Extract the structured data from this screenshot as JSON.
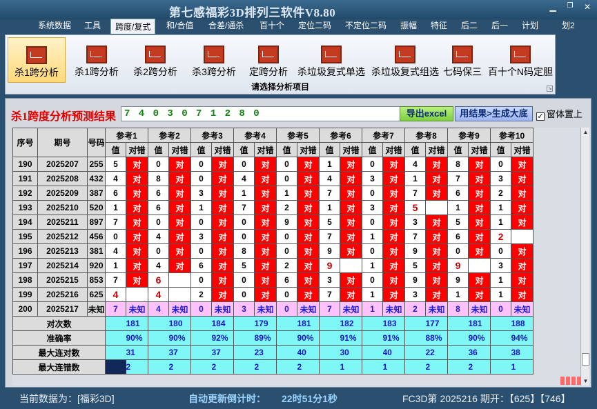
{
  "window": {
    "title": "第七感福彩3D排列三软件V8.80",
    "restore_icon": "restore-icon",
    "close_icon": "close-icon"
  },
  "menu": {
    "items": [
      "系统数据",
      "工具",
      "跨度/复式",
      "和/合值",
      "合差/通杀",
      "百十个",
      "定位二码",
      "不定位二码",
      "振幅",
      "特征",
      "后二",
      "后一",
      "计划",
      "划2"
    ],
    "active": "跨度/复式"
  },
  "ribbon": {
    "buttons": [
      "杀1跨分析",
      "杀1跨分析",
      "杀2跨分析",
      "杀3跨分析",
      "定跨分析",
      "杀垃圾复式单选",
      "杀垃圾复式组选",
      "七码保三",
      "百十个N码定胆"
    ],
    "selected_index": 0,
    "icon_name": "chart-icon",
    "caption": "请选择分析项目"
  },
  "result": {
    "label": "杀1跨度分析预测结果",
    "value": "7 4 0 3 0 7 1 2 8 0",
    "export_label": "导出excel",
    "generate_label": "用结果>生成大底",
    "topmost_label": "窗体置上",
    "topmost_checked": true
  },
  "table": {
    "headers": {
      "seq": "序号",
      "period": "期号",
      "number": "号码"
    },
    "ref_groups": [
      "参考1",
      "参考2",
      "参考3",
      "参考4",
      "参考5",
      "参考6",
      "参考7",
      "参考8",
      "参考9",
      "参考10"
    ],
    "sub_headers": {
      "value": "值",
      "result": "对错"
    },
    "result_labels": {
      "correct": "对",
      "wrong": "错",
      "unknown": "未知"
    },
    "rows": [
      {
        "seq": "190",
        "period": "2025207",
        "number": "255",
        "refs": [
          "5",
          "0",
          "0",
          "0",
          "0",
          "1",
          "0",
          "4",
          "8",
          "0"
        ],
        "ok": [
          1,
          1,
          1,
          1,
          1,
          1,
          1,
          1,
          1,
          1
        ]
      },
      {
        "seq": "191",
        "period": "2025208",
        "number": "432",
        "refs": [
          "4",
          "8",
          "0",
          "4",
          "0",
          "4",
          "3",
          "1",
          "7",
          "3"
        ],
        "ok": [
          1,
          1,
          1,
          1,
          1,
          1,
          1,
          1,
          1,
          1
        ]
      },
      {
        "seq": "192",
        "period": "2025209",
        "number": "387",
        "refs": [
          "6",
          "6",
          "3",
          "1",
          "1",
          "7",
          "0",
          "7",
          "6",
          "2"
        ],
        "ok": [
          1,
          1,
          1,
          1,
          1,
          1,
          1,
          1,
          1,
          1
        ]
      },
      {
        "seq": "193",
        "period": "2025210",
        "number": "520",
        "refs": [
          "1",
          "6",
          "1",
          "7",
          "2",
          "1",
          "3",
          "5",
          "1",
          "1"
        ],
        "ok": [
          1,
          1,
          1,
          1,
          1,
          1,
          1,
          0,
          1,
          1
        ]
      },
      {
        "seq": "194",
        "period": "2025211",
        "number": "897",
        "refs": [
          "7",
          "0",
          "0",
          "0",
          "9",
          "5",
          "0",
          "3",
          "5",
          "1"
        ],
        "ok": [
          1,
          1,
          1,
          1,
          1,
          1,
          1,
          1,
          1,
          1
        ]
      },
      {
        "seq": "195",
        "period": "2025212",
        "number": "456",
        "refs": [
          "0",
          "4",
          "3",
          "0",
          "0",
          "7",
          "1",
          "7",
          "6",
          "2"
        ],
        "ok": [
          1,
          1,
          1,
          1,
          1,
          1,
          1,
          1,
          1,
          0
        ]
      },
      {
        "seq": "196",
        "period": "2025213",
        "number": "381",
        "refs": [
          "4",
          "0",
          "0",
          "8",
          "0",
          "9",
          "0",
          "9",
          "0",
          "0"
        ],
        "ok": [
          1,
          1,
          1,
          1,
          1,
          1,
          1,
          1,
          1,
          1
        ]
      },
      {
        "seq": "197",
        "period": "2025214",
        "number": "920",
        "refs": [
          "1",
          "4",
          "6",
          "5",
          "2",
          "9",
          "1",
          "5",
          "9",
          "3"
        ],
        "ok": [
          1,
          1,
          1,
          1,
          1,
          0,
          1,
          1,
          0,
          1
        ]
      },
      {
        "seq": "198",
        "period": "2025215",
        "number": "853",
        "refs": [
          "7",
          "6",
          "0",
          "0",
          "6",
          "3",
          "0",
          "9",
          "9",
          "1"
        ],
        "ok": [
          1,
          0,
          1,
          1,
          1,
          1,
          1,
          1,
          1,
          1
        ]
      },
      {
        "seq": "199",
        "period": "2025216",
        "number": "625",
        "refs": [
          "4",
          "4",
          "2",
          "0",
          "0",
          "7",
          "1",
          "3",
          "1",
          "1"
        ],
        "ok": [
          0,
          0,
          1,
          1,
          1,
          1,
          1,
          1,
          1,
          1
        ]
      }
    ],
    "pred_row": {
      "seq": "200",
      "period": "2025217",
      "number": "未知",
      "refs": [
        "7",
        "4",
        "0",
        "3",
        "0",
        "7",
        "1",
        "2",
        "8",
        "0"
      ]
    },
    "stats": [
      {
        "label": "对次数",
        "values": [
          "181",
          "180",
          "184",
          "179",
          "181",
          "182",
          "183",
          "177",
          "181",
          "188"
        ]
      },
      {
        "label": "准确率",
        "values": [
          "90%",
          "90%",
          "92%",
          "89%",
          "90%",
          "91%",
          "91%",
          "88%",
          "90%",
          "94%"
        ]
      },
      {
        "label": "最大连对数",
        "values": [
          "31",
          "37",
          "37",
          "23",
          "40",
          "30",
          "40",
          "22",
          "36",
          "38"
        ]
      },
      {
        "label": "最大连错数",
        "values": [
          "2",
          "2",
          "2",
          "2",
          "2",
          "1",
          "1",
          "2",
          "2",
          "1"
        ]
      }
    ]
  },
  "status": {
    "current_data_label": "当前数据为：[福彩3D]",
    "countdown_label": "自动更新倒计时：",
    "countdown_value": "22时51分1秒",
    "draw_info": "FC3D第 2025216 期开：【625】【746】"
  },
  "colors": {
    "correct_bg": "#ff0000",
    "stat_bg": "#7ff7f7",
    "pred_bg": "#ffc2ff",
    "title_bg": "#2b4f6e"
  }
}
